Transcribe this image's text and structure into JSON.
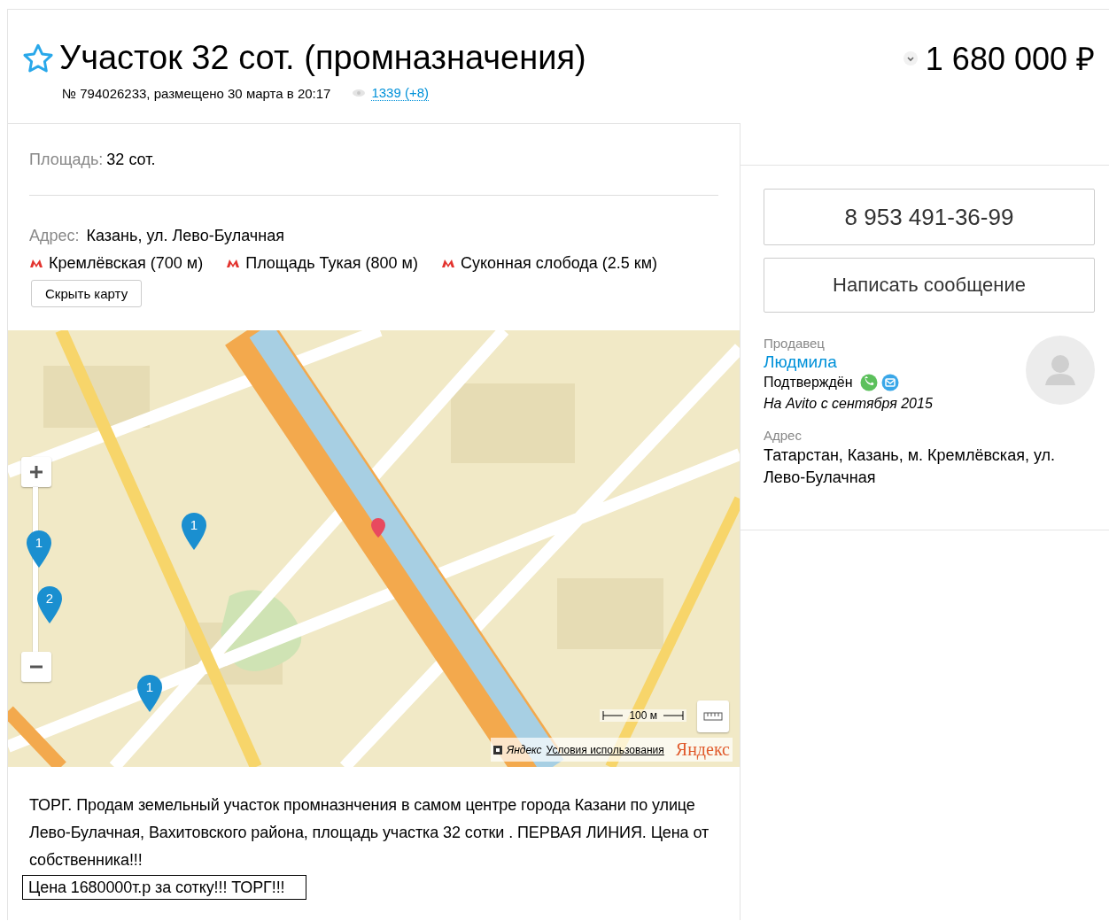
{
  "header": {
    "favorite": false,
    "title": "Участок 32 сот. (промназначения)",
    "meta": "№ 794026233, размещено 30 марта в 20:17",
    "views": "1339 (+8)",
    "price": "1 680 000 ₽"
  },
  "params": [
    {
      "label": "Площадь:",
      "value": "32 сот."
    }
  ],
  "address": {
    "label": "Адрес:",
    "value": "Казань, ул. Лево-Булачная",
    "metro": [
      {
        "name": "Кремлёвская (700 м)"
      },
      {
        "name": "Площадь Тукая (800 м)"
      },
      {
        "name": "Суконная слобода (2.5 км)"
      }
    ],
    "toggle_button": "Скрыть карту"
  },
  "map": {
    "markers": [
      {
        "label": "1"
      },
      {
        "label": "1"
      },
      {
        "label": "2"
      },
      {
        "label": "1"
      }
    ],
    "scale": "100 м",
    "attribution": "Яндекс",
    "terms_link": "Условия использования",
    "logo": "Яндекс"
  },
  "description": {
    "paragraph": "ТОРГ. Продам земельный участок промназнчения в самом центре города Казани по улице Лево-Булачная, Вахитовского района, площадь участка 32 сотки . ПЕРВАЯ ЛИНИЯ. Цена от собственника!!!",
    "boxed_line": "Цена 1680000т.р за сотку!!! ТОРГ!!!"
  },
  "contact": {
    "phone": "8 953 491-36-99",
    "message_button": "Написать сообщение"
  },
  "seller": {
    "label": "Продавец",
    "name": "Людмила",
    "verified_label": "Подтверждён",
    "verified": [
      {
        "kind": "phone"
      },
      {
        "kind": "email"
      }
    ],
    "since": "На Avito с сентября 2015",
    "address_label": "Адрес",
    "address": "Татарстан, Казань, м. Кремлёвская, ул. Лево-Булачная"
  }
}
